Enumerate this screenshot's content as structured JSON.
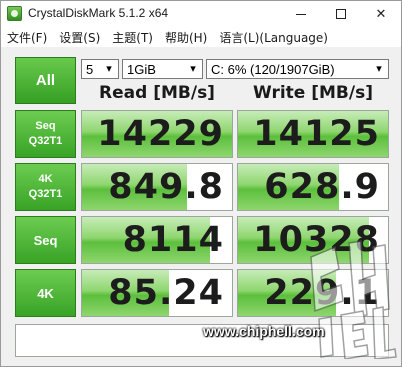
{
  "window": {
    "title": "CrystalDiskMark 5.1.2 x64"
  },
  "menu": [
    {
      "label": "文件(F)"
    },
    {
      "label": "设置(S)"
    },
    {
      "label": "主题(T)"
    },
    {
      "label": "帮助(H)"
    },
    {
      "label": "语言(L)(Language)"
    }
  ],
  "controls": {
    "all_label": "All",
    "count_value": "5",
    "size_value": "1GiB",
    "drive_value": "C: 6% (120/1907GiB)"
  },
  "headers": {
    "read": "Read [MB/s]",
    "write": "Write [MB/s]"
  },
  "rows": [
    {
      "label1": "Seq",
      "label2": "Q32T1",
      "read": "14229",
      "write": "14125",
      "read_fill": 1.0,
      "write_fill": 1.0
    },
    {
      "label1": "4K",
      "label2": "Q32T1",
      "read": "849.8",
      "write": "628.9",
      "read_fill": 0.7,
      "write_fill": 0.67
    },
    {
      "label1": "Seq",
      "label2": "",
      "read": "8114",
      "write": "10328",
      "read_fill": 0.85,
      "write_fill": 0.87
    },
    {
      "label1": "4K",
      "label2": "",
      "read": "85.24",
      "write": "229.1",
      "read_fill": 0.58,
      "write_fill": 0.65
    }
  ],
  "comment": "",
  "watermark": {
    "url": "www.chiphell.com",
    "logo_text": "chip hell"
  },
  "colors": {
    "accent_green": "#3ca428",
    "bar_green": "#8fd66f"
  },
  "icons": {
    "app": "crystaldiskmark-icon",
    "minimize": "minimize-icon",
    "maximize": "maximize-icon",
    "close": "close-icon",
    "dropdown": "chevron-down-icon"
  }
}
